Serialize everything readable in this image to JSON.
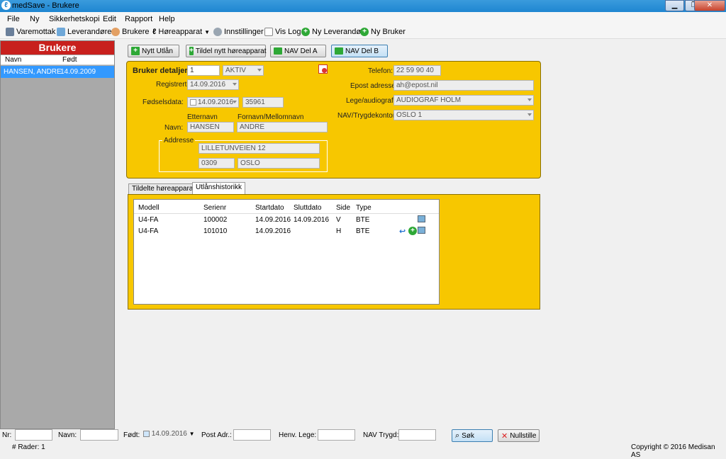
{
  "window": {
    "title": "medSave - Brukere"
  },
  "menu": [
    "File",
    "Ny",
    "Sikkerhetskopi",
    "Edit",
    "Rapport",
    "Help"
  ],
  "toolbar": {
    "varemottak": "Varemottak",
    "leverandorer": "Leverandører",
    "brukere": "Brukere",
    "horeapparat": "Høreapparat",
    "innstillinger": "Innstillinger",
    "vis_log": "Vis Log",
    "ny_leverandor": "Ny Leverandør",
    "ny_bruker": "Ny Bruker"
  },
  "sidebar": {
    "title": "Brukere",
    "col_navn": "Navn",
    "col_fodt": "Født",
    "rows": [
      {
        "navn": "HANSEN, ANDRE",
        "fodt": "14.09.2009"
      }
    ]
  },
  "actions": {
    "nytt_utlan": "Nytt Utlån",
    "tildel": "Tildel nytt høreapparat",
    "nav_a": "NAV Del A",
    "nav_b": "NAV Del B"
  },
  "details": {
    "heading": "Bruker detaljer",
    "id": "1",
    "status": "AKTIV",
    "registrert_label": "Registrert:",
    "registrert": "14.09.2016",
    "fodselsdata_label": "Fødselsdata:",
    "fodselsdato": "14.09.2016",
    "personnr": "35961",
    "etternavn_label": "Etternavn",
    "fornavn_label": "Fornavn/Mellomnavn",
    "navn_label": "Navn:",
    "etternavn": "HANSEN",
    "fornavn": "ANDRE",
    "adresse_label": "Addresse",
    "adresse": "LILLETUNVEIEN 12",
    "postnr": "0309",
    "poststed": "OSLO",
    "telefon_label": "Telefon:",
    "telefon": "22 59 90 40",
    "epost_label": "Epost adresse:",
    "epost": "ah@epost.nil",
    "lege_label": "Lege/audiograf:",
    "lege": "AUDIOGRAF HOLM",
    "nav_label": "NAV/Trygdekontor:",
    "nav": "OSLO 1"
  },
  "tabs": {
    "tab1": "Tildelte høreapparater",
    "tab2": "Utlånshistorikk"
  },
  "grid": {
    "headers": {
      "modell": "Modell",
      "serienr": "Serienr",
      "startdato": "Startdato",
      "sluttdato": "Sluttdato",
      "side": "Side",
      "type": "Type"
    },
    "rows": [
      {
        "modell": "U4-FA",
        "serienr": "100002",
        "startdato": "14.09.2016",
        "sluttdato": "14.09.2016",
        "side": "V",
        "type": "BTE"
      },
      {
        "modell": "U4-FA",
        "serienr": "101010",
        "startdato": "14.09.2016",
        "sluttdato": "",
        "side": "H",
        "type": "BTE"
      }
    ]
  },
  "search": {
    "nr": "Nr:",
    "navn": "Navn:",
    "fodt": "Født:",
    "fodt_value": "14.09.2016",
    "post": "Post Adr.:",
    "henv": "Henv. Lege:",
    "nav": "NAV Trygd:",
    "sok": "Søk",
    "nullstille": "Nullstille"
  },
  "status": {
    "rows": "# Rader: 1",
    "copyright": "Copyright © 2016 Medisan AS"
  }
}
